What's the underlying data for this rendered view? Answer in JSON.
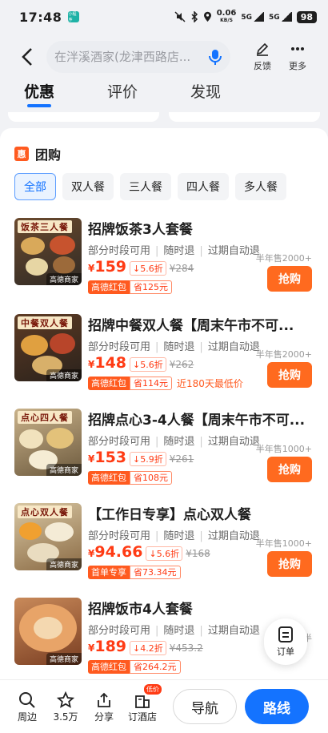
{
  "status_bar": {
    "time": "17:48",
    "mini_app": "小程序",
    "net_speed": "0.06",
    "net_unit": "KB/S",
    "sig1": "5G",
    "sig2": "5G",
    "battery": "98"
  },
  "header": {
    "search_placeholder": "在泮溪酒家(龙津西路店...",
    "feedback_label": "反馈",
    "more_label": "更多"
  },
  "tabs": [
    {
      "label": "优惠",
      "active": true
    },
    {
      "label": "评价"
    },
    {
      "label": "发现"
    }
  ],
  "section": {
    "icon_text": "惠",
    "title": "团购"
  },
  "filters": [
    "全部",
    "双人餐",
    "三人餐",
    "四人餐",
    "多人餐"
  ],
  "items": [
    {
      "name": "招牌饭茶3人套餐",
      "banner": "饭茶三人餐",
      "tags": [
        "部分时段可用",
        "随时退",
        "过期自动退"
      ],
      "price": "159",
      "discount": "5.6折",
      "orig": "¥284",
      "coupon_k": "高德红包",
      "coupon_v": "省125元",
      "extra": "",
      "sold": "半年售2000+",
      "buy": "抢购",
      "merchant": "高德商家"
    },
    {
      "name": "招牌中餐双人餐【周末午市不可...",
      "banner": "中餐双人餐",
      "tags": [
        "部分时段可用",
        "随时退",
        "过期自动退"
      ],
      "price": "148",
      "discount": "5.6折",
      "orig": "¥262",
      "coupon_k": "高德红包",
      "coupon_v": "省114元",
      "extra": "近180天最低价",
      "sold": "半年售2000+",
      "buy": "抢购",
      "merchant": "高德商家"
    },
    {
      "name": "招牌点心3-4人餐【周末午市不可...",
      "banner": "点心四人餐",
      "tags": [
        "部分时段可用",
        "随时退",
        "过期自动退"
      ],
      "price": "153",
      "discount": "5.9折",
      "orig": "¥261",
      "coupon_k": "高德红包",
      "coupon_v": "省108元",
      "extra": "",
      "sold": "半年售1000+",
      "buy": "抢购",
      "merchant": "高德商家"
    },
    {
      "name": "【工作日专享】点心双人餐",
      "banner": "点心双人餐",
      "tags": [
        "部分时段可用",
        "随时退",
        "过期自动退"
      ],
      "price": "94.66",
      "discount": "5.6折",
      "orig": "¥168",
      "coupon_k": "首单专享",
      "coupon_v": "省73.34元",
      "extra": "",
      "sold": "半年售1000+",
      "buy": "抢购",
      "merchant": "高德商家"
    },
    {
      "name": "招牌饭市4人套餐",
      "banner": "",
      "tags": [
        "部分时段可用",
        "随时退",
        "过期自动退"
      ],
      "price": "189",
      "discount": "4.2折",
      "orig": "¥453.2",
      "coupon_k": "高德红包",
      "coupon_v": "省264.2元",
      "extra": "",
      "sold": "半",
      "buy": "抢购",
      "merchant": "高德商家"
    }
  ],
  "currency": "¥",
  "discount_arrow": "↓",
  "order_float": {
    "label": "订单"
  },
  "bottom_bar": {
    "nearby": "周边",
    "favorites": "3.5万",
    "share": "分享",
    "hotel": "订酒店",
    "hotel_badge": "低价",
    "nav": "导航",
    "route": "路线"
  },
  "colors": {
    "accent": "#1473ff",
    "price": "#ff3b14",
    "buy": "#ff6a1f"
  }
}
